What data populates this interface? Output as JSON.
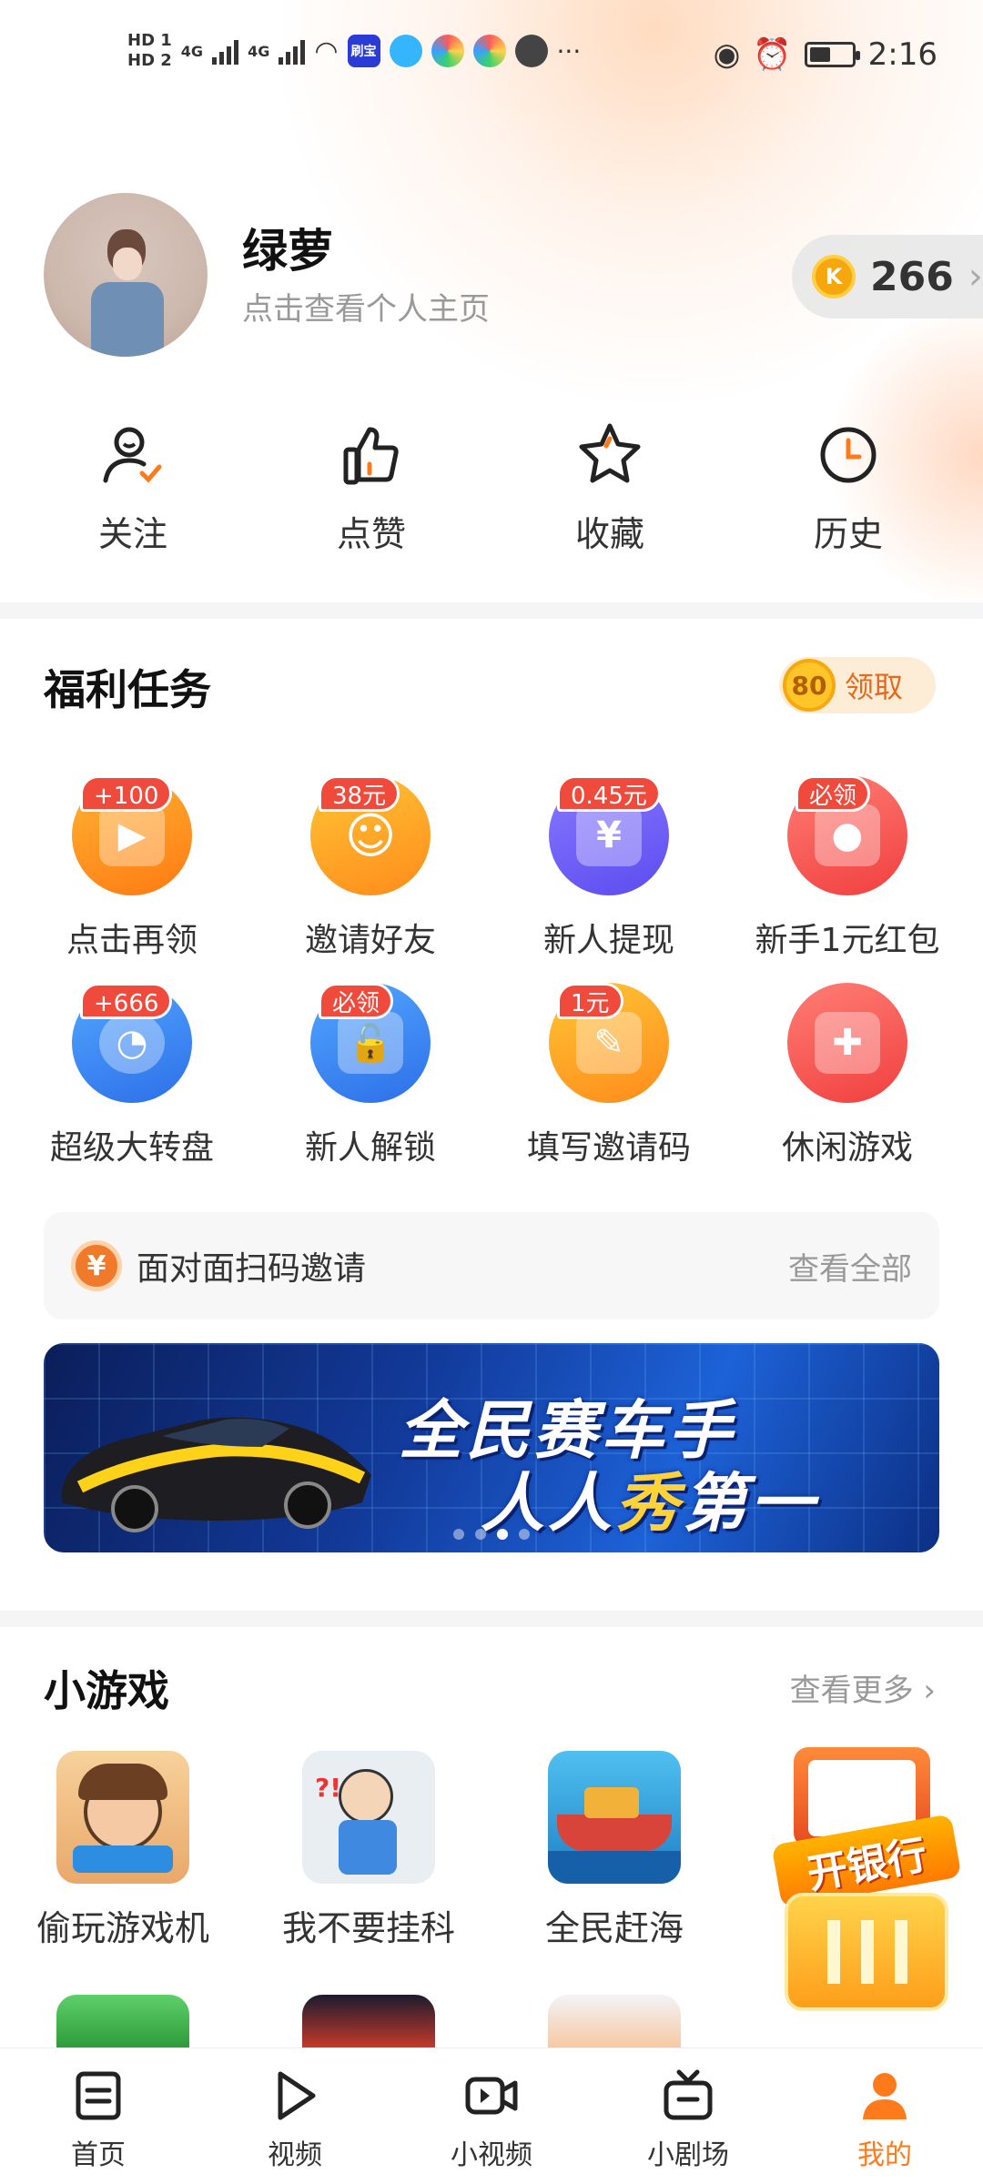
{
  "status_bar": {
    "hd1": "HD 1",
    "hd2": "HD 2",
    "net1": "4G",
    "net2": "4G",
    "app_badge": "刷宝",
    "more": "···",
    "time": "2:16"
  },
  "profile": {
    "name": "绿萝",
    "subtitle": "点击查看个人主页"
  },
  "coins": {
    "icon_letter": "K",
    "value": "266"
  },
  "quick_actions": [
    {
      "label": "关注"
    },
    {
      "label": "点赞"
    },
    {
      "label": "收藏"
    },
    {
      "label": "历史"
    }
  ],
  "welfare": {
    "title": "福利任务",
    "claim_value": "80",
    "claim_label": "领取",
    "tasks": [
      {
        "label": "点击再领",
        "badge": "+100"
      },
      {
        "label": "邀请好友",
        "badge": "38元"
      },
      {
        "label": "新人提现",
        "badge": "0.45元"
      },
      {
        "label": "新手1元红包",
        "badge": "必领"
      },
      {
        "label": "超级大转盘",
        "badge": "+666"
      },
      {
        "label": "新人解锁",
        "badge": "必领"
      },
      {
        "label": "填写邀请码",
        "badge": "1元"
      },
      {
        "label": "休闲游戏",
        "badge": ""
      }
    ]
  },
  "invite": {
    "icon_text": "¥",
    "text": "面对面扫码邀请",
    "view_all": "查看全部"
  },
  "banner": {
    "line1": "全民赛车手",
    "line2_a": "人人",
    "line2_hl": "秀",
    "line2_b": "第一",
    "active_dot": 3
  },
  "mini_games": {
    "title": "小游戏",
    "more": "查看更多",
    "items": [
      {
        "label": "偷玩游戏机"
      },
      {
        "label": "我不要挂科"
      },
      {
        "label": "全民赶海"
      }
    ],
    "promo_text": "开银行"
  },
  "bottom_nav": [
    {
      "label": "首页"
    },
    {
      "label": "视频"
    },
    {
      "label": "小视频"
    },
    {
      "label": "小剧场"
    },
    {
      "label": "我的"
    }
  ],
  "colors": {
    "accent": "#ff7a1a",
    "badge_red": "#f04a3c"
  }
}
